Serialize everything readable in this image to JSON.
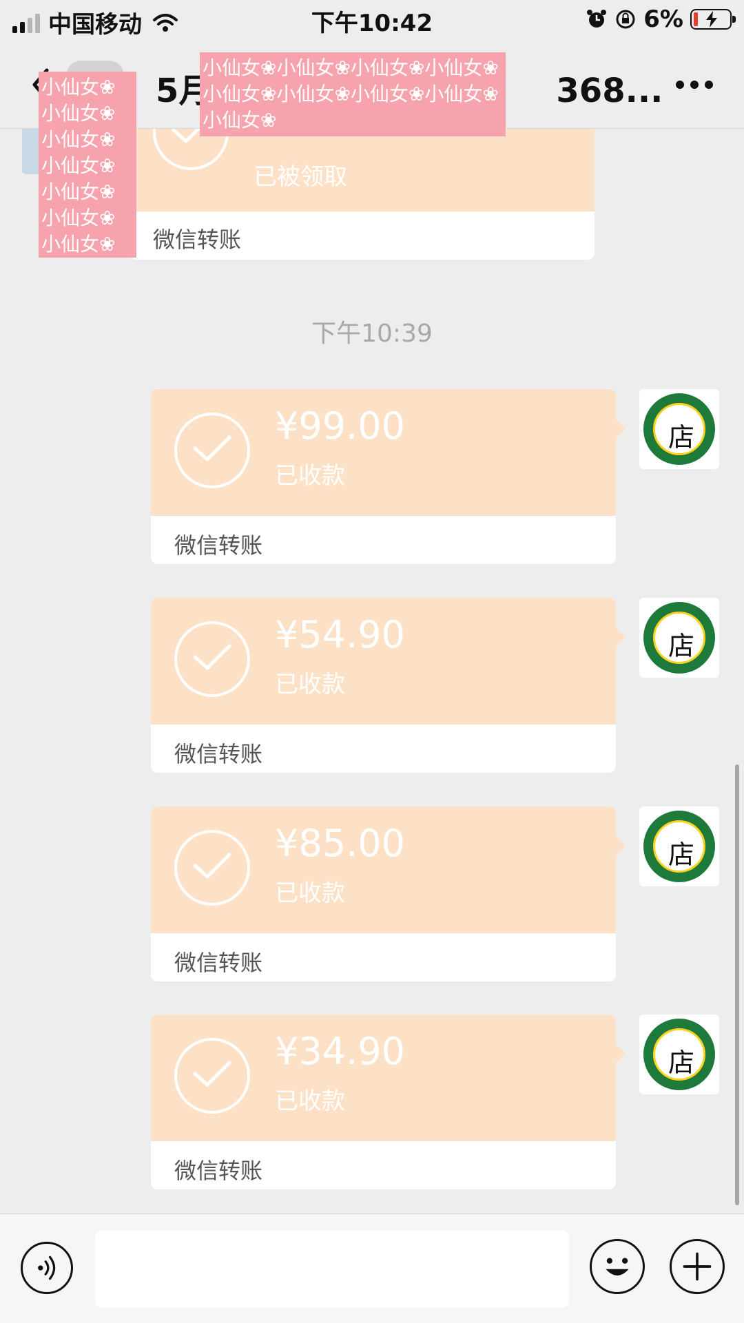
{
  "status_bar": {
    "carrier": "中国移动",
    "time": "下午10:42",
    "battery": "6%",
    "battery_color": "#e63b2e"
  },
  "nav": {
    "title_start": "5月",
    "title_end": "368...",
    "back_icon": "chevron-left-icon",
    "more_icon": "more-icon"
  },
  "redaction_text": "小仙女❀小仙女❀小仙女❀小仙女❀小仙女❀小仙女❀小仙女❀小仙女❀小仙女❀",
  "chat": {
    "partial_transfer": {
      "status": "已被领取",
      "label": "微信转账"
    },
    "timestamp": "下午10:39",
    "transfers": [
      {
        "amount": "¥99.00",
        "status": "已收款",
        "label": "微信转账"
      },
      {
        "amount": "¥54.90",
        "status": "已收款",
        "label": "微信转账"
      },
      {
        "amount": "¥85.00",
        "status": "已收款",
        "label": "微信转账"
      },
      {
        "amount": "¥34.90",
        "status": "已收款",
        "label": "微信转账"
      }
    ],
    "avatar_logo_char": "店",
    "card_color": "#fde1c6"
  },
  "input_bar": {
    "voice_icon": "voice-icon",
    "emoji_icon": "emoji-icon",
    "plus_icon": "plus-icon",
    "placeholder": ""
  }
}
